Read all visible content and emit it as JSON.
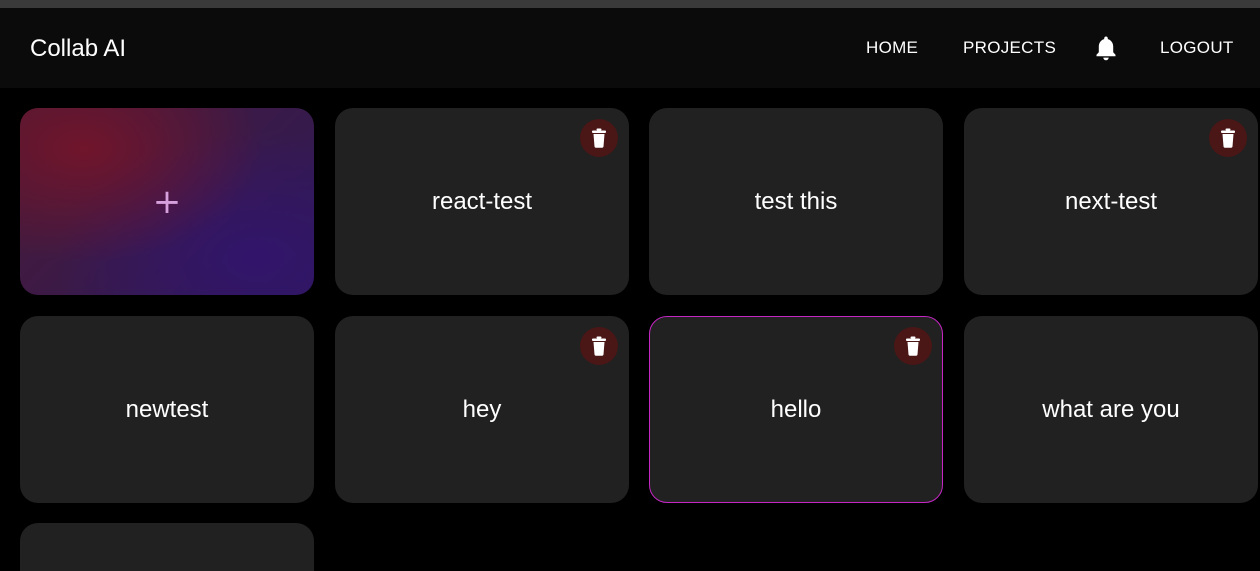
{
  "header": {
    "brand": "Collab AI",
    "nav": {
      "home": "HOME",
      "projects": "PROJECTS",
      "notifications_icon": "bell-icon",
      "logout": "LOGOUT"
    }
  },
  "projects": {
    "new_project_symbol": "+",
    "cards": [
      {
        "title": "react-test",
        "deletable": true
      },
      {
        "title": "test this",
        "deletable": false
      },
      {
        "title": "next-test",
        "deletable": true
      },
      {
        "title": "newtest",
        "deletable": false
      },
      {
        "title": "hey",
        "deletable": true
      },
      {
        "title": "hello",
        "deletable": true,
        "selected": true
      },
      {
        "title": "what are you",
        "deletable": false
      },
      {
        "title": "",
        "deletable": false
      }
    ],
    "delete_icon": "trash-icon"
  },
  "colors": {
    "background": "#000000",
    "navbar": "#0b0b0b",
    "card": "#212121",
    "delete_button": "#4a1616",
    "selected_border": "#c427c4",
    "plus": "#d6a0dc"
  }
}
